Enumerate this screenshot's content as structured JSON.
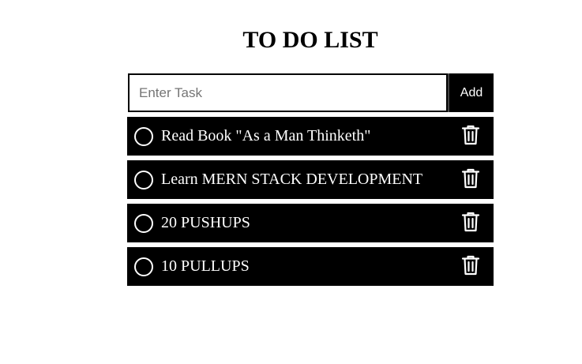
{
  "header": {
    "title": "TO DO LIST"
  },
  "input": {
    "placeholder": "Enter Task",
    "value": "",
    "add_label": "Add"
  },
  "tasks": [
    {
      "text": "Read Book \"As a Man Thinketh\"",
      "completed": false,
      "icon": "trash-icon"
    },
    {
      "text": "Learn MERN STACK DEVELOPMENT",
      "completed": false,
      "icon": "trash-icon"
    },
    {
      "text": "20 PUSHUPS",
      "completed": false,
      "icon": "trash-icon"
    },
    {
      "text": "10 PULLUPS",
      "completed": false,
      "icon": "trash-icon"
    }
  ],
  "colors": {
    "background": "#ffffff",
    "item_background": "#000000",
    "item_text": "#ffffff",
    "accent": "#000000"
  }
}
